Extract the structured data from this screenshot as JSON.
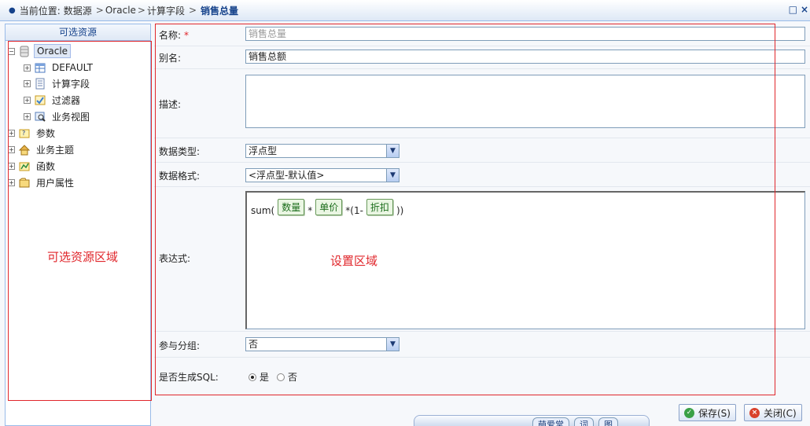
{
  "breadcrumb": {
    "prefix": "当前位置:",
    "items": [
      "数据源",
      "Oracle",
      "计算字段"
    ],
    "separator": ">",
    "current": "销售总量"
  },
  "window_controls": {
    "maximize": "□",
    "close": "×"
  },
  "left_panel": {
    "title": "可选资源",
    "tree": [
      {
        "label": "Oracle",
        "icon": "database-icon",
        "level": 0,
        "expander": "−",
        "selected": true
      },
      {
        "label": "DEFAULT",
        "icon": "table-icon",
        "level": 1,
        "expander": "+"
      },
      {
        "label": "计算字段",
        "icon": "document-icon",
        "level": 1,
        "expander": "+"
      },
      {
        "label": "过滤器",
        "icon": "filter-icon",
        "level": 1,
        "expander": "+"
      },
      {
        "label": "业务视图",
        "icon": "view-icon",
        "level": 1,
        "expander": "+"
      },
      {
        "label": "参数",
        "icon": "parameter-icon",
        "level": 0,
        "expander": "+"
      },
      {
        "label": "业务主题",
        "icon": "theme-icon",
        "level": 0,
        "expander": "+"
      },
      {
        "label": "函数",
        "icon": "function-icon",
        "level": 0,
        "expander": "+"
      },
      {
        "label": "用户属性",
        "icon": "user-attribute-icon",
        "level": 0,
        "expander": "+"
      }
    ]
  },
  "annotations": {
    "left": "可选资源区域",
    "right": "设置区域"
  },
  "form": {
    "name": {
      "label": "名称:",
      "required_mark": "*",
      "value": "销售总量"
    },
    "alias": {
      "label": "别名:",
      "value": "销售总额"
    },
    "description": {
      "label": "描述:",
      "value": ""
    },
    "data_type": {
      "label": "数据类型:",
      "value": "浮点型"
    },
    "data_format": {
      "label": "数据格式:",
      "value": "<浮点型-默认值>"
    },
    "expression": {
      "label": "表达式:",
      "parts": [
        {
          "kind": "text",
          "value": "sum("
        },
        {
          "kind": "token",
          "value": "数量"
        },
        {
          "kind": "text",
          "value": "*"
        },
        {
          "kind": "token",
          "value": "单价"
        },
        {
          "kind": "text",
          "value": "*(1-"
        },
        {
          "kind": "token",
          "value": "折扣"
        },
        {
          "kind": "text",
          "value": "))"
        }
      ]
    },
    "grouping": {
      "label": "参与分组:",
      "value": "否"
    },
    "generate_sql": {
      "label": "是否生成SQL:",
      "options": [
        "是",
        "否"
      ],
      "selected": "是"
    }
  },
  "buttons": {
    "save": "保存(S)",
    "close": "关闭(C)"
  },
  "ime_toolbar": {
    "mode": "萌爱常",
    "items": [
      "词",
      "图"
    ]
  },
  "colors": {
    "accent": "#15428b",
    "annotation": "#e0262b",
    "token_bg": "#eaf6e3",
    "token_text": "#1d6e1d"
  }
}
